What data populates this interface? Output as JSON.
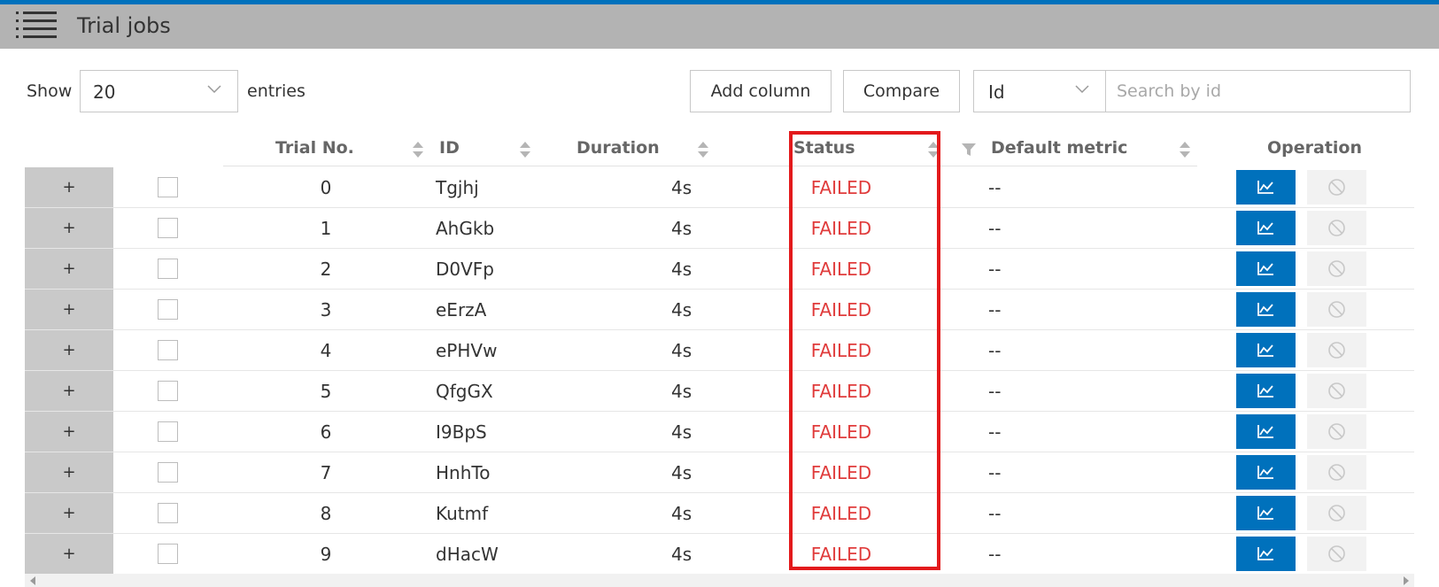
{
  "header": {
    "title": "Trial jobs",
    "menu_icon": "hamburger-list-icon"
  },
  "colors": {
    "topline": "#0071bc",
    "titlebar": "#b3b3b3",
    "failed": "#e03c3c",
    "primary_button": "#0071bc",
    "highlight": "#e31a1c"
  },
  "controls": {
    "show_label": "Show",
    "page_size": "20",
    "entries_label": "entries",
    "add_column": "Add column",
    "compare": "Compare",
    "search_type": "Id",
    "search_placeholder": "Search by id"
  },
  "table": {
    "columns": {
      "trial_no": "Trial No.",
      "id": "ID",
      "duration": "Duration",
      "status": "Status",
      "metric": "Default metric",
      "operation": "Operation"
    },
    "rows": [
      {
        "expand": "+",
        "trial_no": "0",
        "id": "Tgjhj",
        "duration": "4s",
        "status": "FAILED",
        "metric": "--"
      },
      {
        "expand": "+",
        "trial_no": "1",
        "id": "AhGkb",
        "duration": "4s",
        "status": "FAILED",
        "metric": "--"
      },
      {
        "expand": "+",
        "trial_no": "2",
        "id": "D0VFp",
        "duration": "4s",
        "status": "FAILED",
        "metric": "--"
      },
      {
        "expand": "+",
        "trial_no": "3",
        "id": "eErzA",
        "duration": "4s",
        "status": "FAILED",
        "metric": "--"
      },
      {
        "expand": "+",
        "trial_no": "4",
        "id": "ePHVw",
        "duration": "4s",
        "status": "FAILED",
        "metric": "--"
      },
      {
        "expand": "+",
        "trial_no": "5",
        "id": "QfgGX",
        "duration": "4s",
        "status": "FAILED",
        "metric": "--"
      },
      {
        "expand": "+",
        "trial_no": "6",
        "id": "I9BpS",
        "duration": "4s",
        "status": "FAILED",
        "metric": "--"
      },
      {
        "expand": "+",
        "trial_no": "7",
        "id": "HnhTo",
        "duration": "4s",
        "status": "FAILED",
        "metric": "--"
      },
      {
        "expand": "+",
        "trial_no": "8",
        "id": "Kutmf",
        "duration": "4s",
        "status": "FAILED",
        "metric": "--"
      },
      {
        "expand": "+",
        "trial_no": "9",
        "id": "dHacW",
        "duration": "4s",
        "status": "FAILED",
        "metric": "--"
      }
    ],
    "row_icons": {
      "detail": "line-chart-icon",
      "kill": "ban-icon"
    }
  }
}
